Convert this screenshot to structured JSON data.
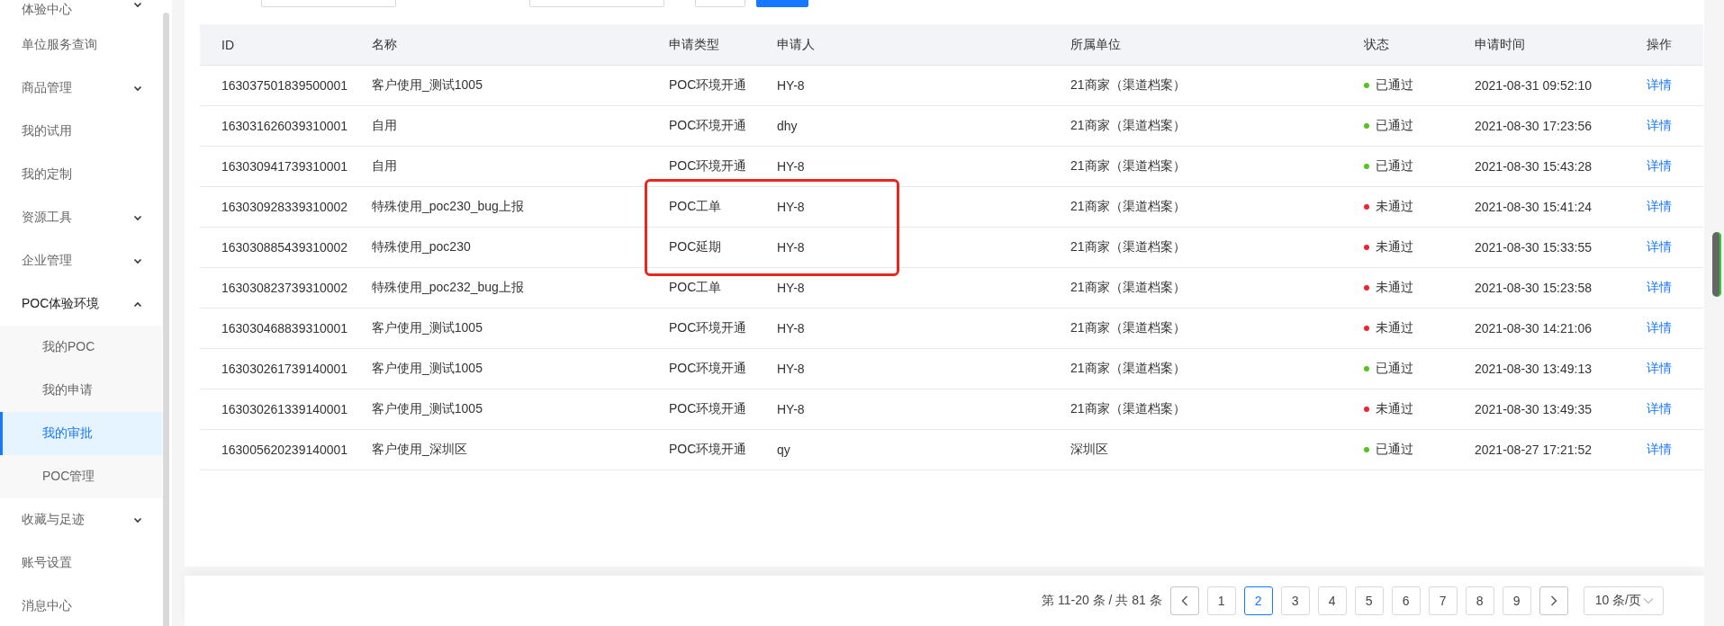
{
  "sidebar": {
    "items": [
      {
        "label": "体验中心",
        "kind": "group",
        "expanded": false
      },
      {
        "label": "单位服务查询",
        "kind": "link"
      },
      {
        "label": "商品管理",
        "kind": "group",
        "expanded": false
      },
      {
        "label": "我的试用",
        "kind": "link"
      },
      {
        "label": "我的定制",
        "kind": "link"
      },
      {
        "label": "资源工具",
        "kind": "group",
        "expanded": false
      },
      {
        "label": "企业管理",
        "kind": "group",
        "expanded": false
      },
      {
        "label": "POC体验环境",
        "kind": "group",
        "expanded": true,
        "children": [
          {
            "label": "我的POC",
            "selected": false
          },
          {
            "label": "我的申请",
            "selected": false
          },
          {
            "label": "我的审批",
            "selected": true
          },
          {
            "label": "POC管理",
            "selected": false
          }
        ]
      },
      {
        "label": "收藏与足迹",
        "kind": "group",
        "expanded": false
      },
      {
        "label": "账号设置",
        "kind": "link"
      },
      {
        "label": "消息中心",
        "kind": "link"
      }
    ]
  },
  "table": {
    "columns": [
      "ID",
      "名称",
      "申请类型",
      "申请人",
      "所属单位",
      "状态",
      "申请时间",
      "操作"
    ],
    "rows": [
      {
        "id": "163037501839500001",
        "name": "客户使用_测试1005",
        "type": "POC环境开通",
        "applicant": "HY-8",
        "unit": "21商家（渠道档案）",
        "status": "已通过",
        "color": "#52c41a",
        "time": "2021-08-31 09:52:10",
        "action": "详情"
      },
      {
        "id": "163031626039310001",
        "name": "自用",
        "type": "POC环境开通",
        "applicant": "dhy",
        "unit": "21商家（渠道档案）",
        "status": "已通过",
        "color": "#52c41a",
        "time": "2021-08-30 17:23:56",
        "action": "详情"
      },
      {
        "id": "163030941739310001",
        "name": "自用",
        "type": "POC环境开通",
        "applicant": "HY-8",
        "unit": "21商家（渠道档案）",
        "status": "已通过",
        "color": "#52c41a",
        "time": "2021-08-30 15:43:28",
        "action": "详情"
      },
      {
        "id": "163030928339310002",
        "name": "特殊使用_poc230_bug上报",
        "type": "POC工单",
        "applicant": "HY-8",
        "unit": "21商家（渠道档案）",
        "status": "未通过",
        "color": "#f5222d",
        "time": "2021-08-30 15:41:24",
        "action": "详情"
      },
      {
        "id": "163030885439310002",
        "name": "特殊使用_poc230",
        "type": "POC延期",
        "applicant": "HY-8",
        "unit": "21商家（渠道档案）",
        "status": "未通过",
        "color": "#f5222d",
        "time": "2021-08-30 15:33:55",
        "action": "详情"
      },
      {
        "id": "163030823739310002",
        "name": "特殊使用_poc232_bug上报",
        "type": "POC工单",
        "applicant": "HY-8",
        "unit": "21商家（渠道档案）",
        "status": "未通过",
        "color": "#f5222d",
        "time": "2021-08-30 15:23:58",
        "action": "详情"
      },
      {
        "id": "163030468839310001",
        "name": "客户使用_测试1005",
        "type": "POC环境开通",
        "applicant": "HY-8",
        "unit": "21商家（渠道档案）",
        "status": "未通过",
        "color": "#f5222d",
        "time": "2021-08-30 14:21:06",
        "action": "详情"
      },
      {
        "id": "163030261739140001",
        "name": "客户使用_测试1005",
        "type": "POC环境开通",
        "applicant": "HY-8",
        "unit": "21商家（渠道档案）",
        "status": "已通过",
        "color": "#52c41a",
        "time": "2021-08-30 13:49:13",
        "action": "详情"
      },
      {
        "id": "163030261339140001",
        "name": "客户使用_测试1005",
        "type": "POC环境开通",
        "applicant": "HY-8",
        "unit": "21商家（渠道档案）",
        "status": "未通过",
        "color": "#f5222d",
        "time": "2021-08-30 13:49:35",
        "action": "详情"
      },
      {
        "id": "163005620239140001",
        "name": "客户使用_深圳区",
        "type": "POC环境开通",
        "applicant": "qy",
        "unit": "深圳区",
        "status": "已通过",
        "color": "#52c41a",
        "time": "2021-08-27 17:21:52",
        "action": "详情"
      }
    ]
  },
  "pagination": {
    "summary": "第 11-20 条 / 共 81 条",
    "pages": [
      {
        "label": "1",
        "selected": false
      },
      {
        "label": "2",
        "selected": true
      },
      {
        "label": "3",
        "selected": false
      },
      {
        "label": "4",
        "selected": false
      },
      {
        "label": "5",
        "selected": false
      },
      {
        "label": "6",
        "selected": false
      },
      {
        "label": "7",
        "selected": false
      },
      {
        "label": "8",
        "selected": false
      },
      {
        "label": "9",
        "selected": false
      }
    ],
    "page_size": "10 条/页"
  }
}
